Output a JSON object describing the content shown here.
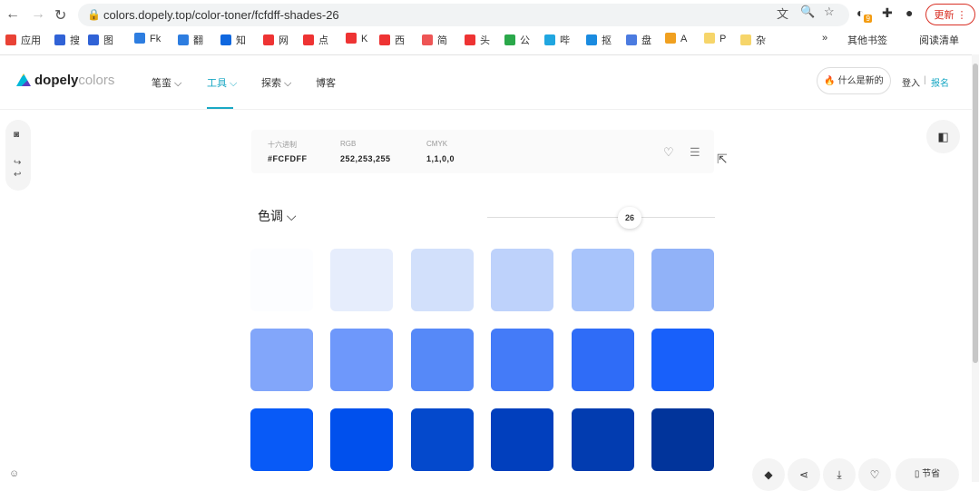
{
  "browser": {
    "url": "colors.dopely.top/color-toner/fcfdff-shades-26",
    "update_label": "更新",
    "ext_badge": "9",
    "bookmarks": [
      {
        "label": "应用",
        "color": "#e94235"
      },
      {
        "label": "搜",
        "color": "#3062d6"
      },
      {
        "label": "图",
        "color": "#3062d6"
      },
      {
        "label": "Fk",
        "color": "#2d7de0"
      },
      {
        "label": "翻",
        "color": "#2d7de0"
      },
      {
        "label": "知",
        "color": "#0f67df"
      },
      {
        "label": "网",
        "color": "#e33"
      },
      {
        "label": "点",
        "color": "#e33"
      },
      {
        "label": "K",
        "color": "#e33"
      },
      {
        "label": "西",
        "color": "#e33"
      },
      {
        "label": "简",
        "color": "#e55"
      },
      {
        "label": "头",
        "color": "#e33"
      },
      {
        "label": "公",
        "color": "#2aa84a"
      },
      {
        "label": "哔",
        "color": "#20a6e0"
      },
      {
        "label": "抠",
        "color": "#1a8be0"
      },
      {
        "label": "盘",
        "color": "#4b7be0"
      },
      {
        "label": "A",
        "color": "#f0a020"
      },
      {
        "label": "P",
        "color": "#f6d56a"
      },
      {
        "label": "杂",
        "color": "#f6d56a"
      }
    ],
    "more_bookmarks": "»",
    "other_bookmarks": "其他书签",
    "reading_list": "阅读清单"
  },
  "site": {
    "logo_main": "dopely",
    "logo_sub": "colors",
    "menu": [
      {
        "label": "笔蛮 ⌵",
        "active": false
      },
      {
        "label": "工具 ⌵",
        "active": true
      },
      {
        "label": "探索 ⌵",
        "active": false
      },
      {
        "label": "博客",
        "active": false
      }
    ],
    "whats_new": "🔥 什么是新的",
    "login": "登入",
    "separator": "|",
    "signup": "报名"
  },
  "color_info": {
    "hex_label": "十六进制",
    "hex_value": "#FCFDFF",
    "rgb_label": "RGB",
    "rgb_value": "252,253,255",
    "cmyk_label": "CMYK",
    "cmyk_value": "1,1,0,0"
  },
  "shades": {
    "title": "色调 ⌵",
    "slider_value": "26",
    "colors": [
      "#fcfdff",
      "#e6edfc",
      "#d2e0fb",
      "#bed2fb",
      "#a8c4fb",
      "#91b2f8",
      "#82a6fa",
      "#6e98fb",
      "#5689f8",
      "#447bf8",
      "#2f6cf7",
      "#1860fa",
      "#085af7",
      "#0050ed",
      "#0449cc",
      "#013fbd",
      "#023cb0",
      "#01349b"
    ]
  },
  "bottom": {
    "save_label": "节省"
  }
}
